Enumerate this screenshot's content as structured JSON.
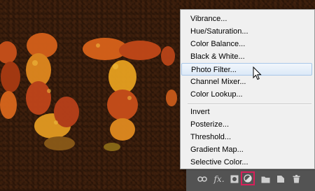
{
  "menu": {
    "items": [
      {
        "label": "Vibrance..."
      },
      {
        "label": "Hue/Saturation..."
      },
      {
        "label": "Color Balance..."
      },
      {
        "label": "Black & White..."
      },
      {
        "label": "Photo Filter..."
      },
      {
        "label": "Channel Mixer..."
      },
      {
        "label": "Color Lookup..."
      },
      {
        "label": "Invert"
      },
      {
        "label": "Posterize..."
      },
      {
        "label": "Threshold..."
      },
      {
        "label": "Gradient Map..."
      },
      {
        "label": "Selective Color..."
      }
    ]
  },
  "toolbar": {
    "icons": [
      {
        "name": "link-icon",
        "glyph": "⊖"
      },
      {
        "name": "fx-icon",
        "glyph": "fx"
      },
      {
        "name": "layer-mask-icon",
        "glyph": "◘"
      },
      {
        "name": "adjustment-layer-icon",
        "glyph": "◐"
      },
      {
        "name": "group-folder-icon",
        "glyph": "▬"
      },
      {
        "name": "new-layer-icon",
        "glyph": "▣"
      },
      {
        "name": "trash-icon",
        "glyph": "🗑"
      }
    ]
  },
  "colors": {
    "highlight_border": "#d8205a",
    "menu_bg": "#f0f0f0",
    "hover_bg": "#dce9f7"
  }
}
